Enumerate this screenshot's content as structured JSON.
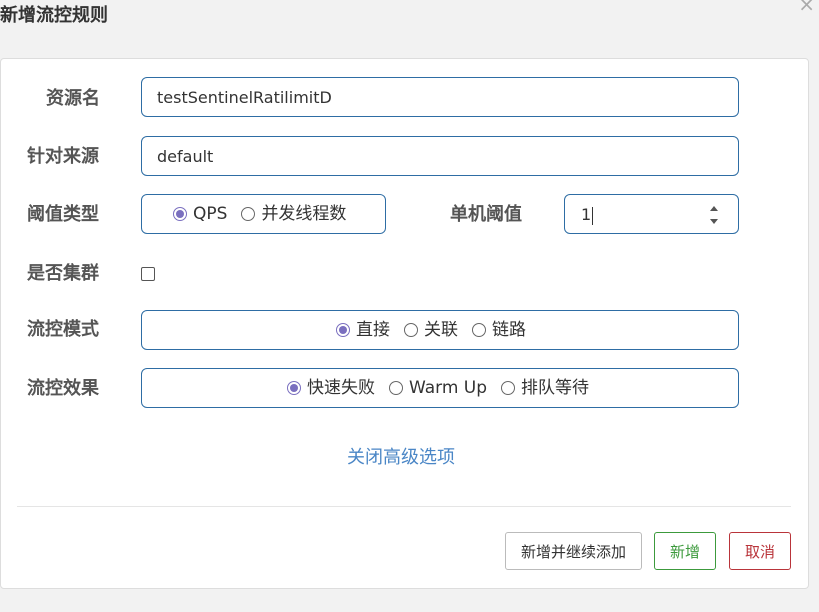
{
  "dialog": {
    "title": "新增流控规则",
    "close_glyph": "×"
  },
  "form": {
    "resource": {
      "label": "资源名",
      "value": "testSentinelRatilimitD"
    },
    "origin": {
      "label": "针对来源",
      "value": "default"
    },
    "threshold_type": {
      "label": "阈值类型",
      "options": [
        {
          "label": "QPS",
          "checked": true
        },
        {
          "label": "并发线程数",
          "checked": false
        }
      ]
    },
    "single_threshold": {
      "label": "单机阈值",
      "value": "1"
    },
    "cluster": {
      "label": "是否集群",
      "checked": false
    },
    "control_mode": {
      "label": "流控模式",
      "options": [
        {
          "label": "直接",
          "checked": true
        },
        {
          "label": "关联",
          "checked": false
        },
        {
          "label": "链路",
          "checked": false
        }
      ]
    },
    "control_effect": {
      "label": "流控效果",
      "options": [
        {
          "label": "快速失败",
          "checked": true
        },
        {
          "label": "Warm Up",
          "checked": false
        },
        {
          "label": "排队等待",
          "checked": false
        }
      ]
    },
    "advanced_link": "关闭高级选项"
  },
  "footer": {
    "add_continue_label": "新增并继续添加",
    "add_label": "新增",
    "cancel_label": "取消"
  },
  "colors": {
    "input_border": "#2e6da4",
    "radio_accent": "#7a6fbf",
    "link": "#4a86c6",
    "add_button": "#3c9a3c",
    "cancel_button": "#b9343a"
  }
}
